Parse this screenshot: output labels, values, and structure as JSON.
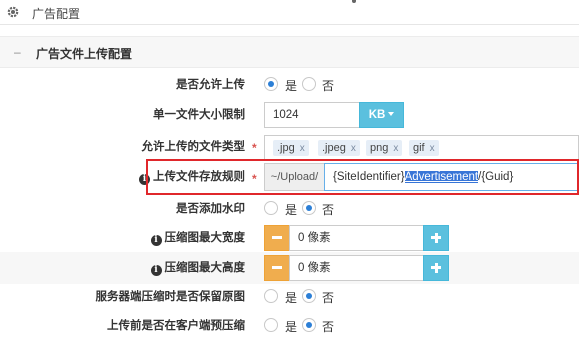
{
  "header": {
    "title": "广告配置",
    "icon": "gear-icon"
  },
  "panel": {
    "collapse": "–",
    "title": "广告文件上传配置"
  },
  "form": {
    "allow_upload": {
      "label": "是否允许上传",
      "yes": "是",
      "no": "否",
      "selected": "是"
    },
    "max_size": {
      "label": "单一文件大小限制",
      "value": "1024",
      "unit": "KB"
    },
    "file_types": {
      "label": "允许上传的文件类型",
      "required": "*",
      "tags": [
        ".jpg",
        ".jpeg",
        "png",
        "gif"
      ],
      "remove": "x"
    },
    "path_rule": {
      "label": "上传文件存放规则",
      "required": "*",
      "prefix": "~/Upload/",
      "value_pre": "{SiteIdentifier}",
      "value_sel": "Advertisement",
      "value_post": "/{Guid}"
    },
    "watermark": {
      "label": "是否添加水印",
      "yes": "是",
      "no": "否",
      "selected": "否"
    },
    "thumb_width": {
      "label": "压缩图最大宽度",
      "value": "0 像素"
    },
    "thumb_height": {
      "label": "压缩图最大高度",
      "value": "0 像素"
    },
    "keep_original": {
      "label": "服务器端压缩时是否保留原图",
      "yes": "是",
      "no": "否",
      "selected": "否"
    },
    "client_compress": {
      "label": "上传前是否在客户端预压缩",
      "yes": "是",
      "no": "否",
      "selected": "否"
    }
  },
  "colors": {
    "accent": "#5bc0de",
    "warning": "#f0ad4e",
    "highlight": "#e0272b",
    "radio": "#2c7fd6"
  }
}
